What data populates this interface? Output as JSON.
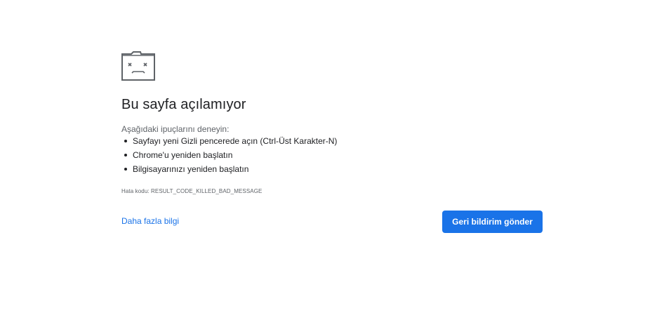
{
  "icon": "sad-folder-icon",
  "title": "Bu sayfa açılamıyor",
  "suggestions": {
    "intro": "Aşağıdaki ipuçlarını deneyin:",
    "items": [
      "Sayfayı yeni Gizli pencerede açın (Ctrl-Üst Karakter-N)",
      "Chrome'u yeniden başlatın",
      "Bilgisayarınızı yeniden başlatın"
    ]
  },
  "error_code": "Hata kodu: RESULT_CODE_KILLED_BAD_MESSAGE",
  "more_info_label": "Daha fazla bilgi",
  "feedback_button_label": "Geri bildirim gönder",
  "colors": {
    "accent": "#1a73e8",
    "text": "#202124",
    "secondary_text": "#5f6368",
    "icon": "#5f6368"
  }
}
